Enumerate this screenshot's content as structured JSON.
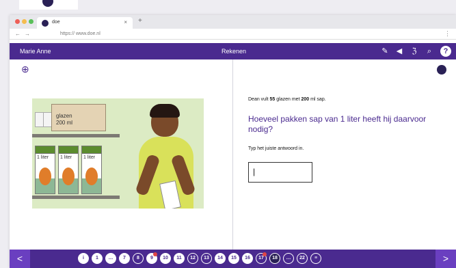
{
  "browser": {
    "tab_title": "doe",
    "tab_close": "×",
    "new_tab": "+",
    "back": "←",
    "forward": "→",
    "url": "https:// www.doe.nl",
    "menu": "⋮"
  },
  "appbar": {
    "user": "Marie Anne",
    "subject": "Rekenen",
    "tools": [
      "pencil-icon",
      "speaker-icon",
      "translate-icon",
      "search-icon",
      "help-icon"
    ],
    "help_label": "?",
    "accent": "#4a2a8f"
  },
  "illustration": {
    "box_label": "glazen\n200 ml",
    "carton_labels": [
      "1 liter",
      "1 liter",
      "1 liter"
    ]
  },
  "question": {
    "intro_pre": "Dean vult ",
    "intro_glasses": "55",
    "intro_mid": " glazen met ",
    "intro_ml": "200",
    "intro_post": " ml sap.",
    "main": "Hoeveel pakken sap van 1 liter heeft hij daarvoor nodig?",
    "instruction": "Typ het juiste antwoord in.",
    "answer_value": "|"
  },
  "navigation": {
    "prev": "<",
    "next": ">",
    "questions": [
      {
        "label": "i",
        "state": "done",
        "flag": false
      },
      {
        "label": "1",
        "state": "done",
        "flag": false
      },
      {
        "label": "…",
        "state": "done",
        "flag": false
      },
      {
        "label": "7",
        "state": "done",
        "flag": false
      },
      {
        "label": "8",
        "state": "open",
        "flag": false
      },
      {
        "label": "9",
        "state": "done",
        "flag": true
      },
      {
        "label": "10",
        "state": "done",
        "flag": false
      },
      {
        "label": "11",
        "state": "done",
        "flag": false
      },
      {
        "label": "12",
        "state": "open",
        "flag": false
      },
      {
        "label": "13",
        "state": "open",
        "flag": false
      },
      {
        "label": "14",
        "state": "done",
        "flag": false
      },
      {
        "label": "15",
        "state": "done",
        "flag": false
      },
      {
        "label": "16",
        "state": "done",
        "flag": false
      },
      {
        "label": "17",
        "state": "open",
        "flag": true
      },
      {
        "label": "18",
        "state": "current",
        "flag": false
      },
      {
        "label": "…",
        "state": "open",
        "flag": false
      },
      {
        "label": "22",
        "state": "open",
        "flag": false
      },
      {
        "label": "≡",
        "state": "open",
        "flag": false
      }
    ]
  }
}
